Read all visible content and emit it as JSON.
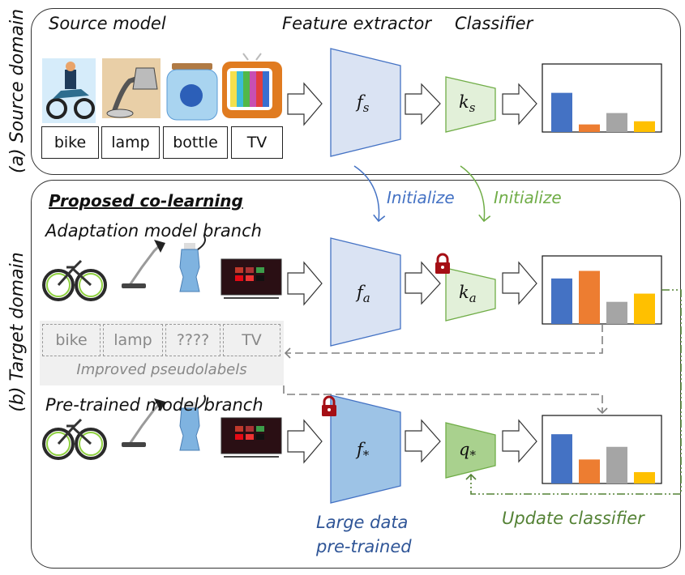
{
  "source_panel": {
    "side_label": "(a) Source domain",
    "heading_source_model": "Source model",
    "heading_feature_extractor": "Feature extractor",
    "heading_classifier": "Classifier",
    "images": [
      "bike",
      "lamp",
      "bottle",
      "tv"
    ],
    "labels": [
      "bike",
      "lamp",
      "bottle",
      "TV"
    ],
    "feature_extractor": {
      "symbol": "f",
      "subscript": "s"
    },
    "classifier": {
      "symbol": "k",
      "subscript": "s"
    },
    "prediction_bars": [
      0.62,
      0.12,
      0.3,
      0.17
    ]
  },
  "initialize_arrows": {
    "feature_label": "Initialize",
    "classifier_label": "Initialize"
  },
  "target_panel": {
    "side_label": "(b) Target domain",
    "title": "Proposed co-learning",
    "adaptation_branch": {
      "heading": "Adaptation model branch",
      "feature_extractor": {
        "symbol": "f",
        "subscript": "a"
      },
      "classifier": {
        "symbol": "k",
        "subscript": "a",
        "locked": true
      },
      "prediction_bars": [
        0.72,
        0.84,
        0.35,
        0.48
      ],
      "pseudolabels": [
        "bike",
        "lamp",
        "????",
        "TV"
      ],
      "pseudolabels_caption": "Improved pseudolabels"
    },
    "pretrained_branch": {
      "heading": "Pre-trained model branch",
      "feature_extractor": {
        "symbol": "f",
        "subscript": "*",
        "locked": true
      },
      "classifier": {
        "symbol": "q",
        "subscript": "*"
      },
      "prediction_bars": [
        0.78,
        0.38,
        0.58,
        0.18
      ],
      "feature_caption_line1": "Large data",
      "feature_caption_line2": "pre-trained",
      "update_label": "Update classifier"
    }
  },
  "colors": {
    "blue_text": "#4472c4",
    "dark_blue_text": "#2f5597",
    "green_text": "#70ad47",
    "dark_green_text": "#548235",
    "bar_colors": [
      "#4472c4",
      "#ed7d31",
      "#a5a5a5",
      "#ffc000"
    ],
    "lock_red": "#a50f15"
  }
}
